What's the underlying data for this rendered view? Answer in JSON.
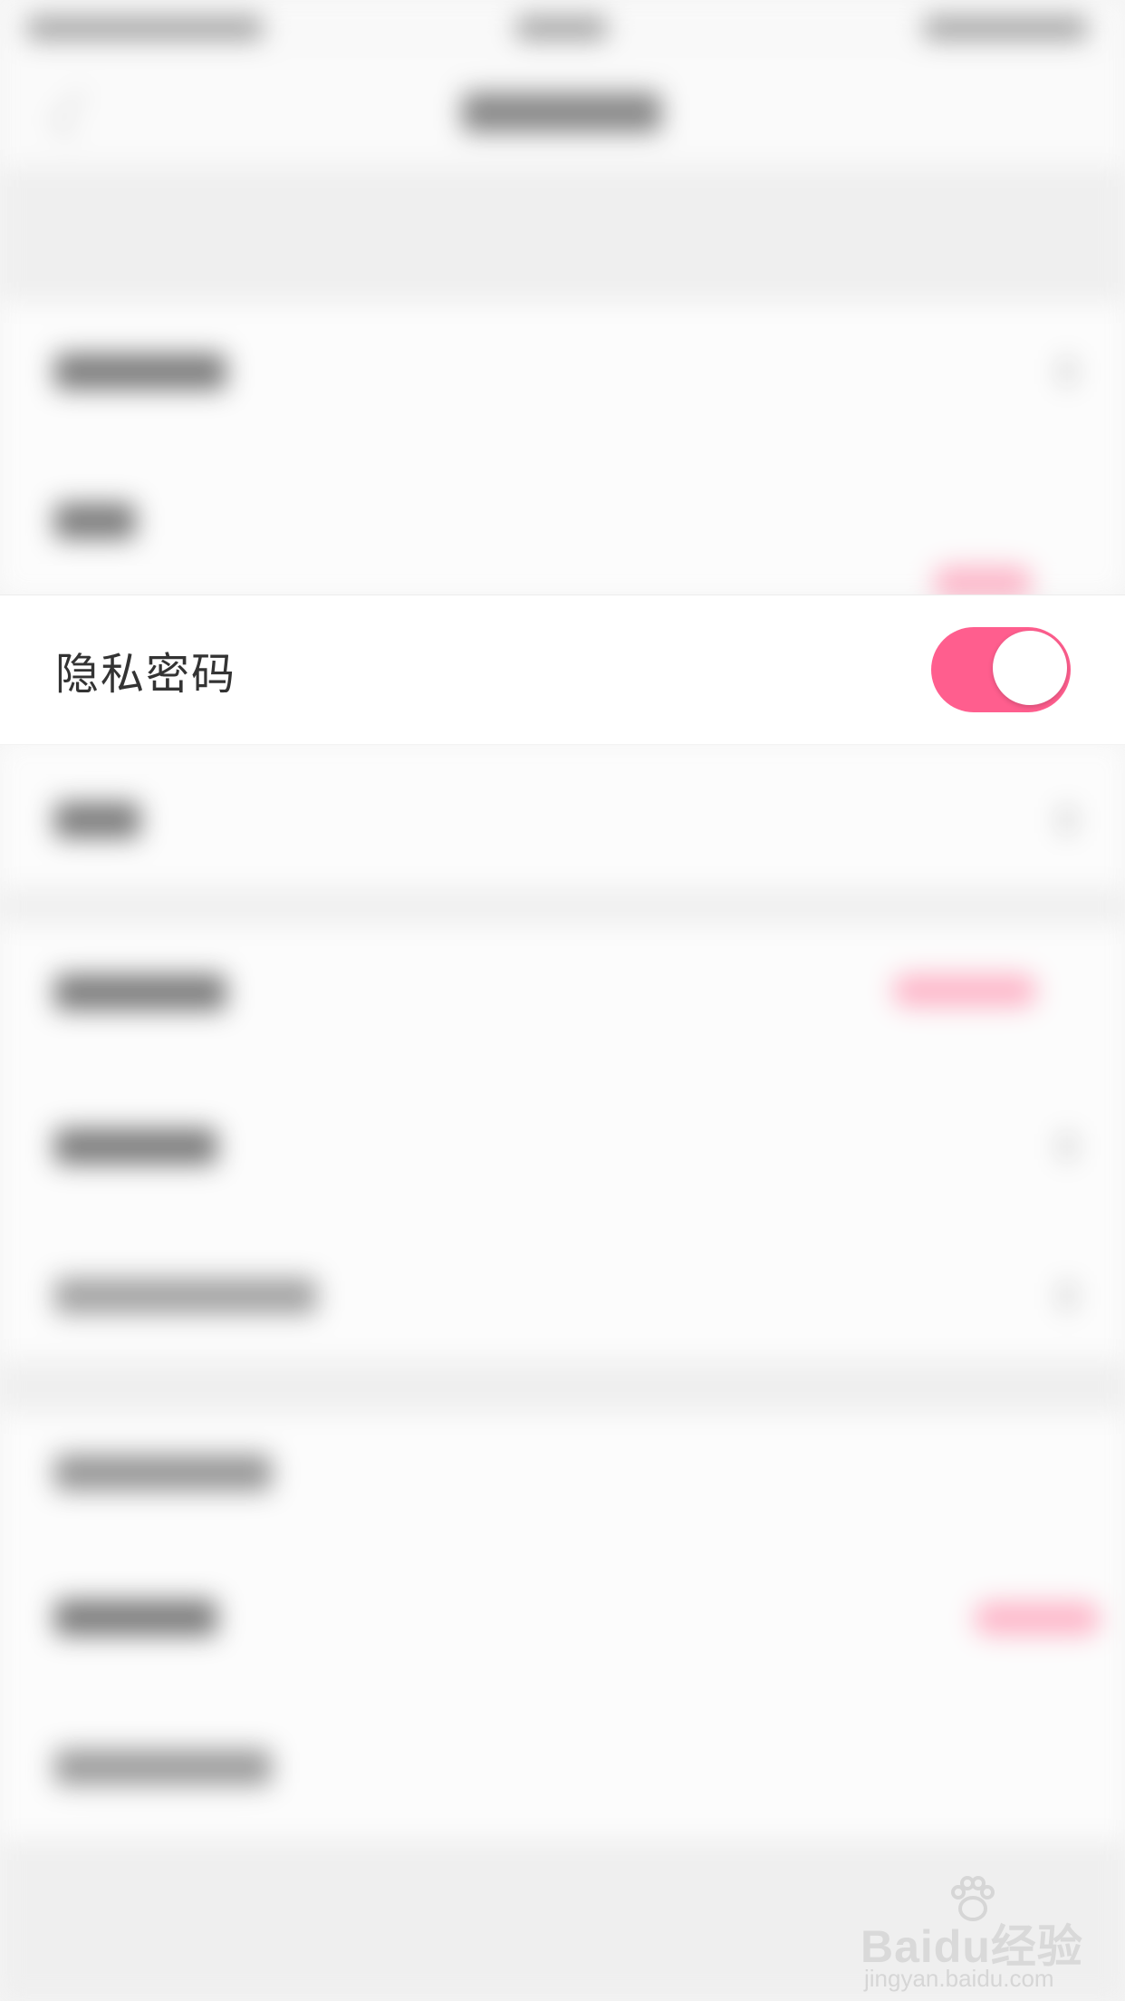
{
  "setting": {
    "label": "隐私密码",
    "enabled": true
  },
  "colors": {
    "accent": "#ff5e8e",
    "background": "#f4f4f4",
    "row": "#ffffff",
    "text": "#333333"
  },
  "watermark": {
    "main": "Baidu经验",
    "sub": "jingyan.baidu.com"
  }
}
